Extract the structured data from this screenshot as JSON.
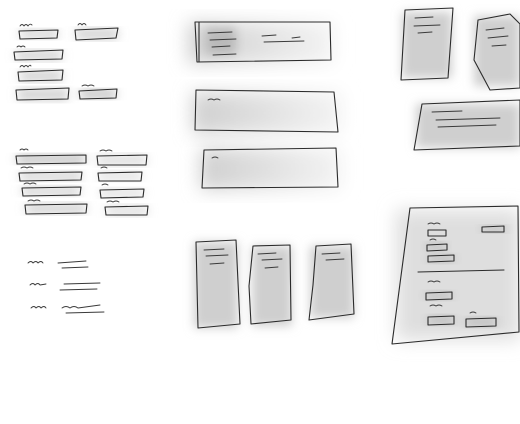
{
  "canvas": {
    "background": "#ffffff",
    "ink_color": "#2b2b2b",
    "shade_colors": [
      "#b9b9b9",
      "#cfcfcf",
      "#dedede"
    ]
  },
  "sketches": [
    {
      "name": "label-and-field-pairs",
      "kind": "form-fields"
    },
    {
      "name": "labelled-bar-list",
      "kind": "form-fields"
    },
    {
      "name": "squiggle-label-rows",
      "kind": "text-rows"
    },
    {
      "name": "wide-banner-panels",
      "kind": "banners"
    },
    {
      "name": "three-card-row",
      "kind": "cards"
    },
    {
      "name": "tilted-cards",
      "kind": "cards"
    },
    {
      "name": "form-page",
      "kind": "page"
    }
  ]
}
